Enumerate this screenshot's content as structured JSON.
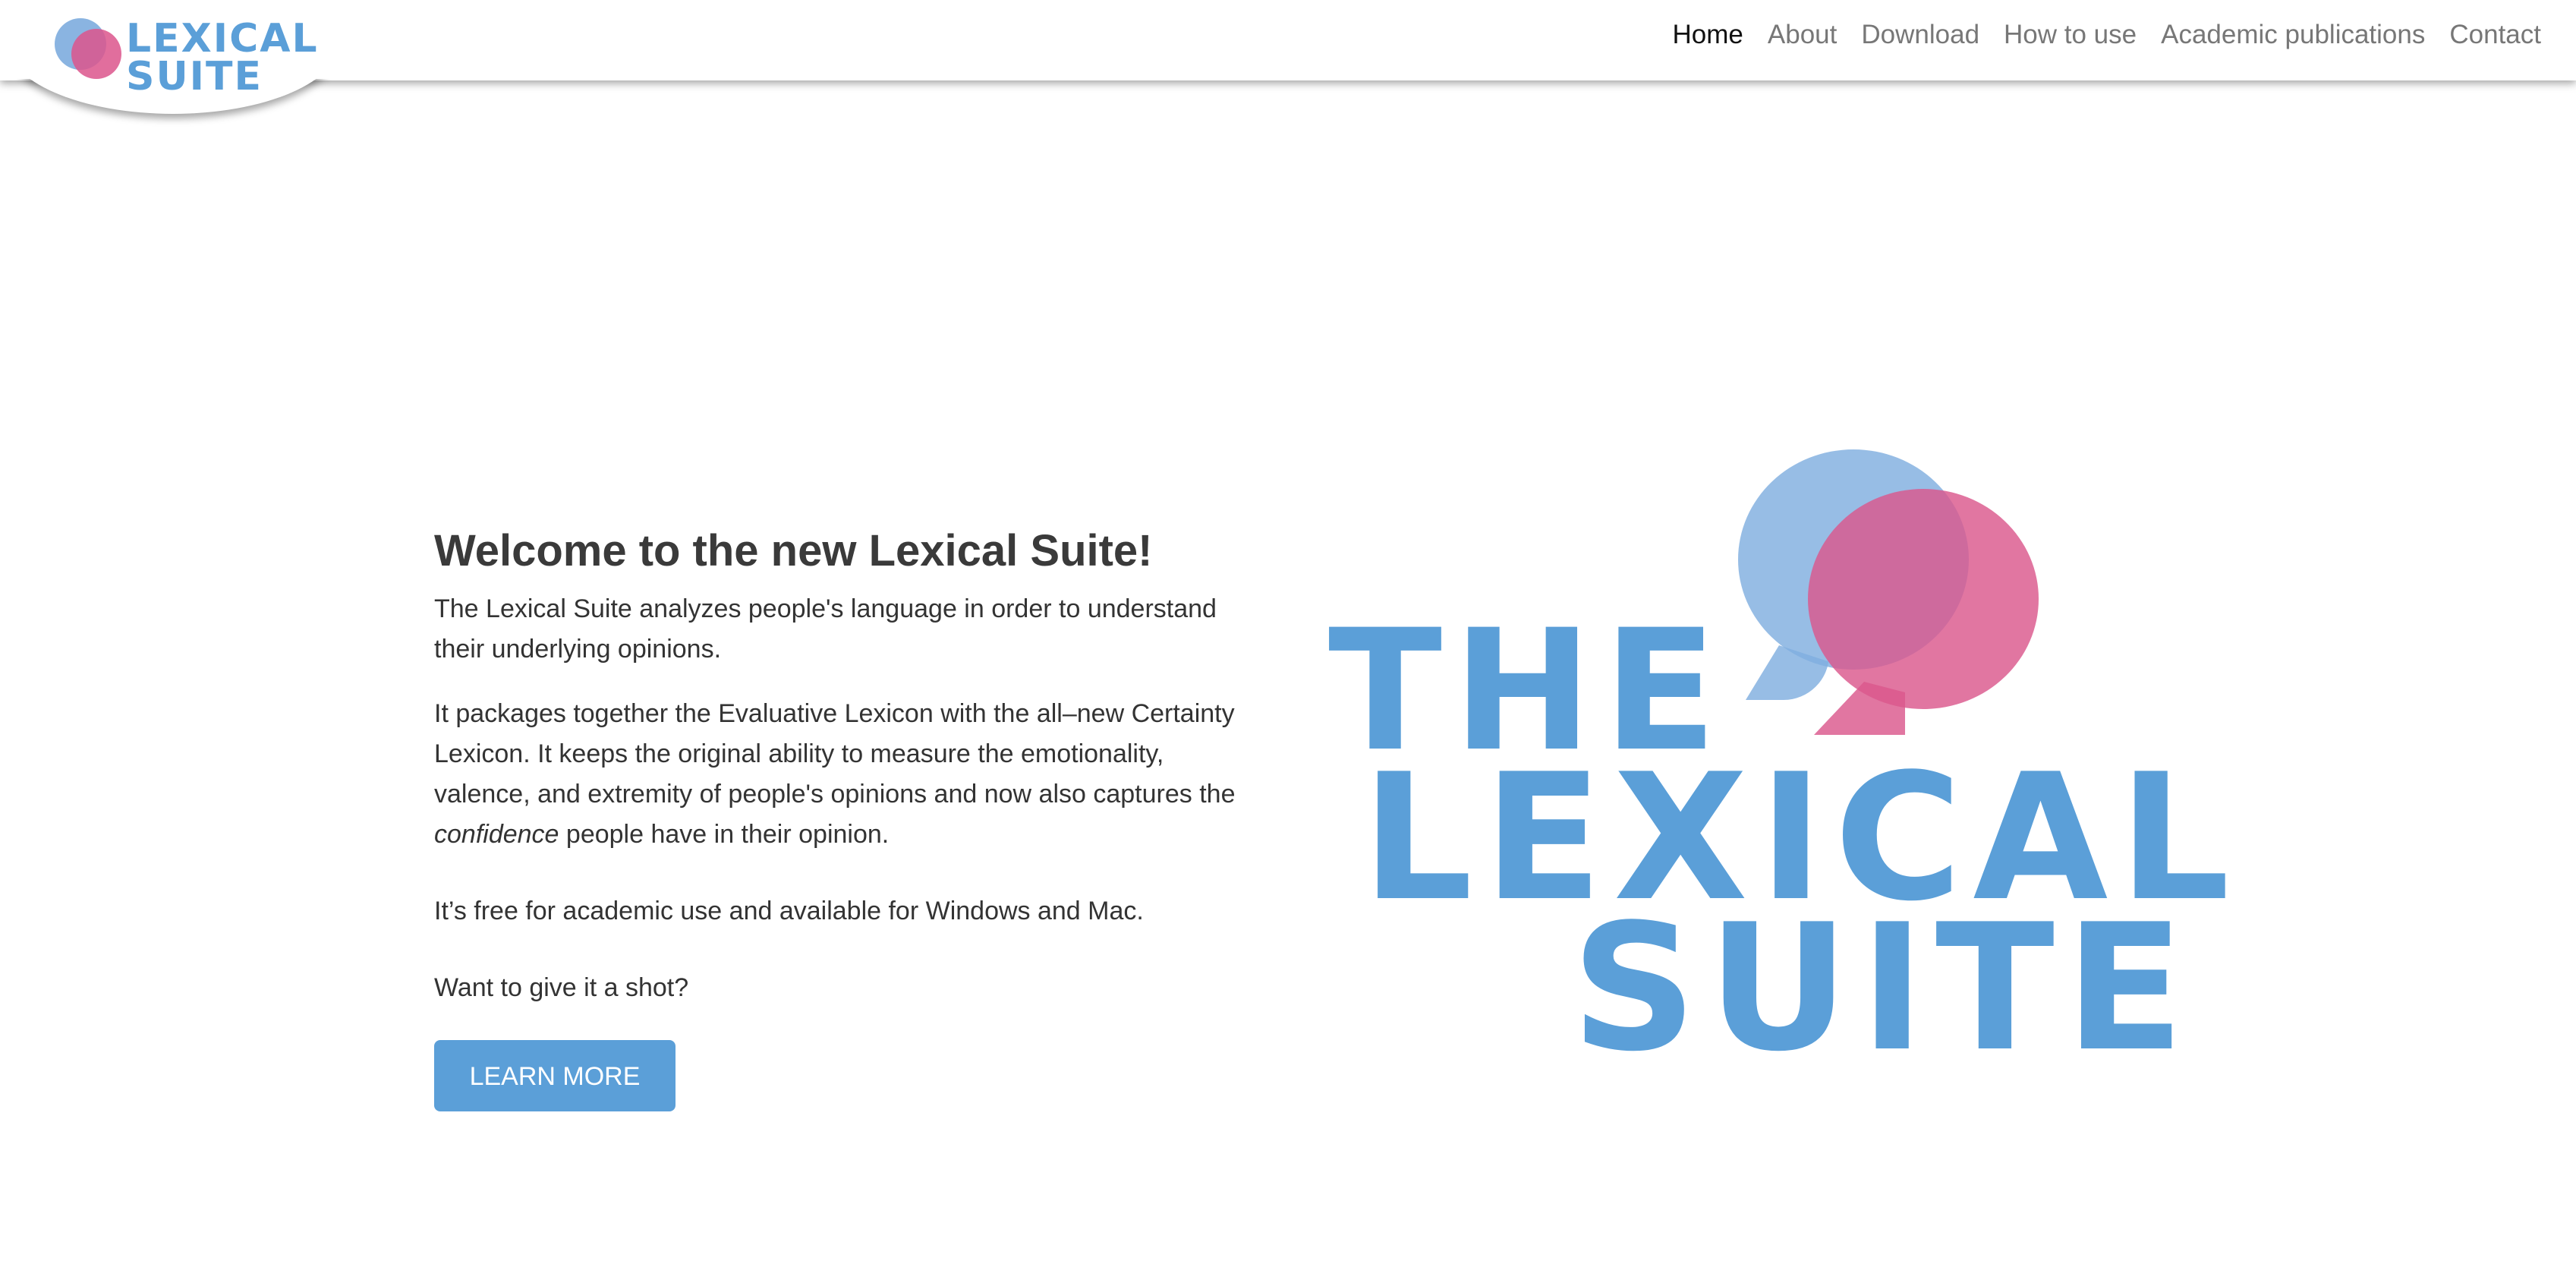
{
  "header": {
    "logo_text_line1": "LEXICAL",
    "logo_text_line2": "SUITE",
    "nav": [
      {
        "label": "Home",
        "active": true
      },
      {
        "label": "About",
        "active": false
      },
      {
        "label": "Download",
        "active": false
      },
      {
        "label": "How to use",
        "active": false
      },
      {
        "label": "Academic publications",
        "active": false
      },
      {
        "label": "Contact",
        "active": false
      }
    ]
  },
  "hero": {
    "title": "Welcome to the new Lexical Suite!",
    "p1": "The Lexical Suite analyzes people's language in order to understand their underlying opinions.",
    "p2_before": "It packages together the Evaluative Lexicon with the all–new Certainty Lexicon. It keeps the original ability to measure the emotionality, valence, and extremity of people's opinions and now also captures the ",
    "p2_emphasis": "confidence",
    "p2_after": " people have in their opinion.",
    "p3": "It’s free for academic use and available for Windows and Mac.",
    "p4": "Want to give it a shot?",
    "button_label": "LEARN MORE"
  },
  "big_logo": {
    "line1": "THE",
    "line2": "LEXICAL",
    "line3": "SUITE"
  },
  "colors": {
    "brand_blue": "#5b9fd8",
    "brand_pink": "#db588c",
    "text": "#333333",
    "nav_inactive": "#777777",
    "nav_active": "#111111"
  }
}
